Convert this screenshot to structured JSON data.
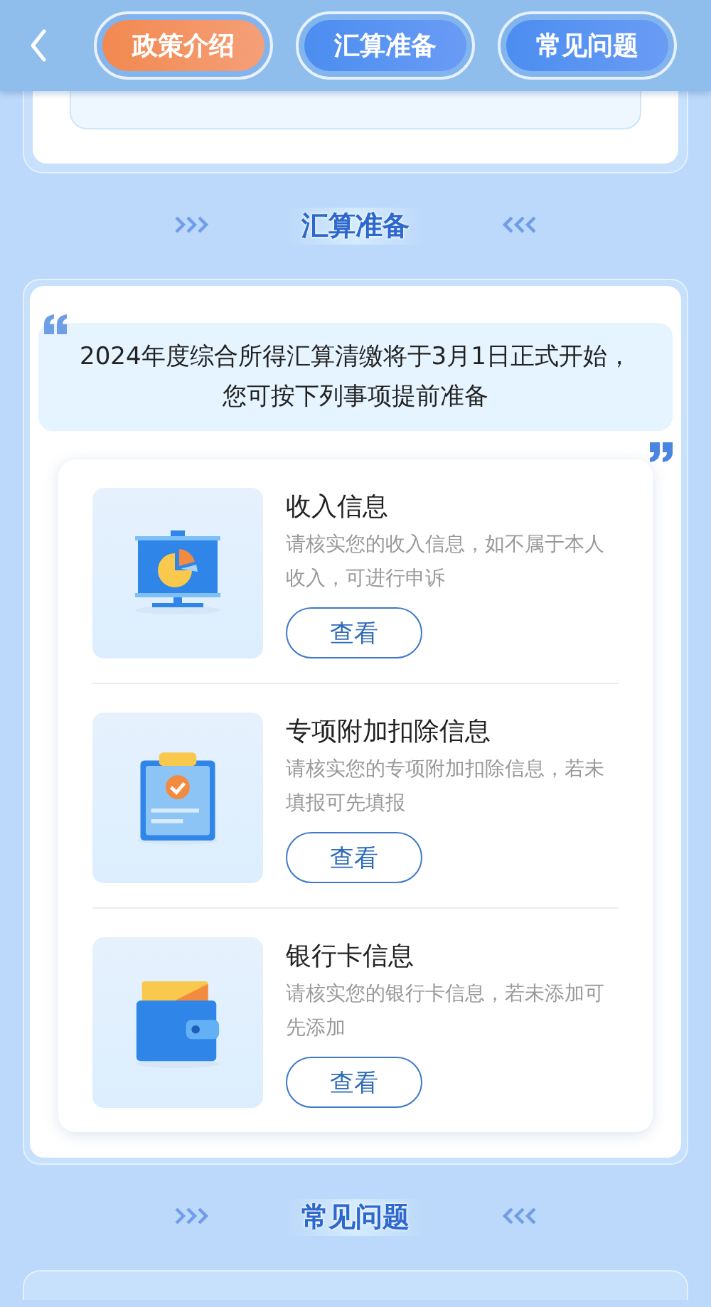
{
  "tabs": [
    {
      "label": "政策介绍",
      "selected": true
    },
    {
      "label": "汇算准备",
      "selected": false
    },
    {
      "label": "常见问题",
      "selected": false
    }
  ],
  "sections": [
    {
      "title": "汇算准备"
    },
    {
      "title": "常见问题"
    }
  ],
  "notice": "2024年度综合所得汇算清缴将于3月1日正式开始，您可按下列事项提前准备",
  "items": [
    {
      "kind": "chart",
      "title": "收入信息",
      "desc": "请核实您的收入信息，如不属于本人收入，可进行申诉",
      "button": "查看"
    },
    {
      "kind": "clipboard",
      "title": "专项附加扣除信息",
      "desc": "请核实您的专项附加扣除信息，若未填报可先填报",
      "button": "查看"
    },
    {
      "kind": "wallet",
      "title": "银行卡信息",
      "desc": "请核实您的银行卡信息，若未添加可先添加",
      "button": "查看"
    }
  ]
}
